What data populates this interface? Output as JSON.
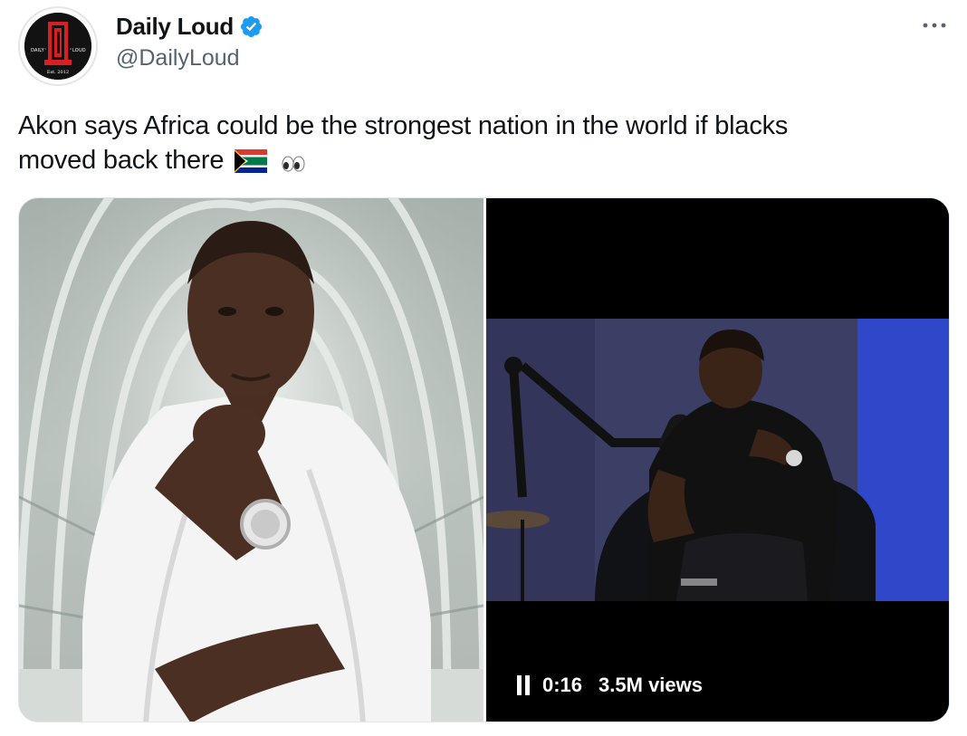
{
  "author": {
    "display_name": "Daily Loud",
    "handle": "@DailyLoud",
    "avatar": {
      "left_text": "DAILY",
      "right_text": "LOUD",
      "bottom_text": "Est. 2012",
      "monogram": "DL",
      "icon": "daily-loud-logo"
    },
    "verified": true
  },
  "tweet": {
    "text_line1": "Akon says Africa could be the strongest nation in the world if blacks",
    "text_line2": "moved back there",
    "emojis": [
      "south-africa-flag",
      "eyes"
    ]
  },
  "media": {
    "video": {
      "time": "0:16",
      "views": "3.5M views",
      "state": "playing"
    }
  },
  "colors": {
    "verified_blue": "#1d9bf0",
    "handle_gray": "#536471",
    "text": "#0f1419"
  }
}
